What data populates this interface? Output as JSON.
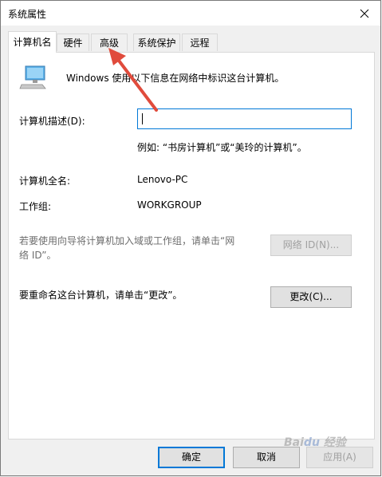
{
  "window": {
    "title": "系统属性"
  },
  "tabs": [
    {
      "label": "计算机名"
    },
    {
      "label": "硬件"
    },
    {
      "label": "高级"
    },
    {
      "label": "系统保护"
    },
    {
      "label": "远程"
    }
  ],
  "info": {
    "text": "Windows 使用以下信息在网络中标识这台计算机。"
  },
  "description": {
    "label": "计算机描述(D):",
    "value": "",
    "example": "例如: “书房计算机”或“美玲的计算机”。"
  },
  "fullname": {
    "label": "计算机全名:",
    "value": "Lenovo-PC"
  },
  "workgroup": {
    "label": "工作组:",
    "value": "WORKGROUP"
  },
  "network": {
    "text_line1": "若要使用向导将计算机加入域或工作组，请单击“网",
    "text_line2": "络 ID”。",
    "button": "网络 ID(N)..."
  },
  "rename": {
    "text": "要重命名这台计算机，请单击“更改”。",
    "button": "更改(C)..."
  },
  "footer": {
    "ok": "确定",
    "cancel": "取消",
    "apply": "应用(A)"
  },
  "colors": {
    "accent": "#0078d7",
    "annotation_arrow": "#e04b3c"
  }
}
